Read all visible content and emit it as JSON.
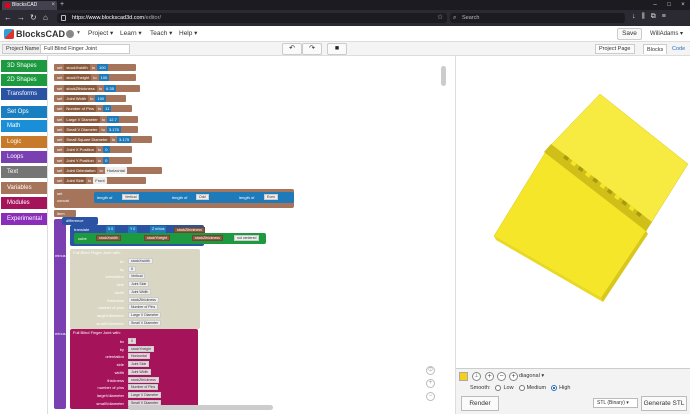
{
  "browser": {
    "tab_title": "BlocksCAD",
    "url_host": "https://www.blockscad3d.com",
    "url_path": "/editor/",
    "search_placeholder": "Search"
  },
  "app": {
    "logo_text": "BlocksCAD",
    "menus": [
      "Project",
      "Learn",
      "Teach",
      "Help"
    ],
    "save_label": "Save",
    "user": "WillAdams"
  },
  "project": {
    "name_label": "Project Name",
    "name_value": "Full Blind Finger Joint",
    "project_page_label": "Project Page",
    "tab_blocks": "Blocks",
    "tab_code": "Code"
  },
  "categories": [
    {
      "label": "3D Shapes",
      "color": "#1d9a3f"
    },
    {
      "label": "2D Shapes",
      "color": "#1d9a3f"
    },
    {
      "label": "Transforms",
      "color": "#2a53a4"
    },
    {
      "label": "Set Ops",
      "color": "#1a7fc0"
    },
    {
      "label": "Math",
      "color": "#1a8fd8"
    },
    {
      "label": "Logic",
      "color": "#c77a2a"
    },
    {
      "label": "Loops",
      "color": "#7a3fb0"
    },
    {
      "label": "Text",
      "color": "#757575"
    },
    {
      "label": "Variables",
      "color": "#a5745b"
    },
    {
      "label": "Modules",
      "color": "#a5145b"
    },
    {
      "label": "Experimental",
      "color": "#8a2db8"
    }
  ],
  "variables": [
    {
      "name": "stockXwidth",
      "value": "100"
    },
    {
      "name": "stockYheight",
      "value": "100"
    },
    {
      "name": "stockZthickness",
      "value": "6.35"
    },
    {
      "name": "Joint Width",
      "value": "100"
    },
    {
      "name": "Number of Pins",
      "value": "11"
    },
    {
      "name": "Large V Diameter",
      "value": "12.7"
    },
    {
      "name": "Small V Diameter",
      "value": "3.175"
    },
    {
      "name": "Small Square Diameter",
      "value": "3.175"
    },
    {
      "name": "Joint X Position",
      "value": "0"
    },
    {
      "name": "Joint Y Position",
      "value": "0"
    },
    {
      "name": "Joint Orientation",
      "value": "Horizontal"
    },
    {
      "name": "Joint Side",
      "value": "Front"
    }
  ],
  "misc_blocks": {
    "to": "to",
    "set": "set",
    "concat": "concat",
    "length_of": "length of",
    "vertical": "Vertical",
    "odd": "Odd",
    "even": "Even",
    "item": "item",
    "difference": "difference",
    "translate": "translate",
    "cube": "cube",
    "not_centered": "not centered",
    "minus": "minus",
    "x_var": "stockXwidth",
    "y_var": "stockYheight",
    "z_var": "stockZthickness"
  },
  "module1": {
    "title": "Full Blind Finger Joint  with:",
    "labels": [
      "bx",
      "by",
      "orientation",
      "side",
      "width",
      "thickness",
      "number of pins",
      "largeVdiameter",
      "smallVdiameter"
    ],
    "values": [
      "stockXwidth",
      "5",
      "Vertical",
      "Joint Side",
      "Joint Width",
      "stockZthickness",
      "Number of Pins",
      "Large V Diameter",
      "Small V Diameter"
    ]
  },
  "module2": {
    "title": "Full Blind Finger Joint  with:",
    "labels": [
      "bx",
      "by",
      "orientation",
      "side",
      "width",
      "thickness",
      "number of pins",
      "largeVdiameter",
      "smallVdiameter"
    ],
    "values": [
      "0",
      "stockYheight",
      "Horizontal",
      "Joint Side",
      "Joint Width",
      "stockZthickness",
      "Number of Pins",
      "Large V Diameter",
      "Small V Diameter"
    ]
  },
  "controls": {
    "view_mode": "diagonal",
    "smooth_label": "Smooth:",
    "smooth_options": [
      "Low",
      "Medium",
      "High"
    ],
    "smooth_selected": "High",
    "render_label": "Render",
    "format": "STL (Binary)",
    "generate_label": "Generate STL",
    "model_color": "#f5d016"
  }
}
